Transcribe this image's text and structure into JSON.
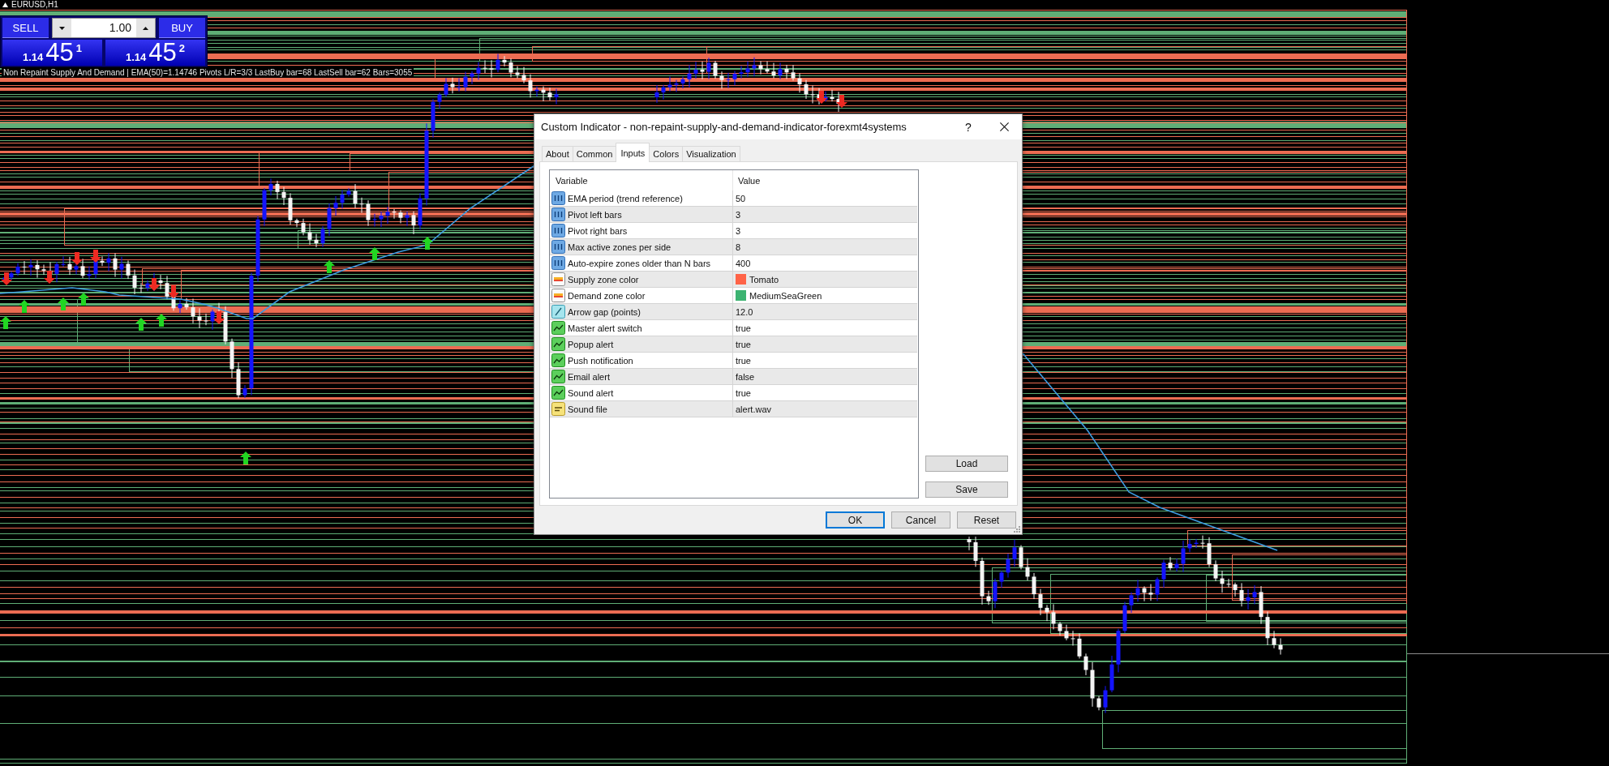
{
  "chart": {
    "symbol": "EURUSD,H1",
    "status": "Non Repaint Supply And Demand | EMA(50)=1.14746 Pivots L/R=3/3 LastBuy bar=68 LastSell bar=62 Bars=3055"
  },
  "trade_panel": {
    "sell_button": "SELL",
    "lot_size": {
      "value": "1.00"
    },
    "buy_button": "BUY",
    "sell_price": {
      "prefix": "1.14",
      "pips": "45",
      "fraction": "1"
    },
    "buy_price": {
      "prefix": "1.14",
      "pips": "45",
      "fraction": "2"
    }
  },
  "dialog": {
    "title": "Custom Indicator - non-repaint-supply-and-demand-indicator-forexmt4systems",
    "help_button": "?",
    "tabs": [
      {
        "label": "About",
        "selected": false
      },
      {
        "label": "Common",
        "selected": false
      },
      {
        "label": "Inputs",
        "selected": true
      },
      {
        "label": "Colors",
        "selected": false
      },
      {
        "label": "Visualization",
        "selected": false
      }
    ],
    "inputs": {
      "columns": [
        "Variable",
        "Value"
      ],
      "rows": [
        {
          "kind": "int",
          "variable": "EMA period (trend reference)",
          "value": "50"
        },
        {
          "kind": "int",
          "variable": "Pivot left bars",
          "value": "3"
        },
        {
          "kind": "int",
          "variable": "Pivot right bars",
          "value": "3"
        },
        {
          "kind": "int",
          "variable": "Max active zones per side",
          "value": "8"
        },
        {
          "kind": "int",
          "variable": "Auto-expire zones older than N bars",
          "value": "400"
        },
        {
          "kind": "color",
          "variable": "Supply zone color",
          "value": "Tomato",
          "color": "#ff6347"
        },
        {
          "kind": "color",
          "variable": "Demand zone color",
          "value": "MediumSeaGreen",
          "color": "#3cb371"
        },
        {
          "kind": "double",
          "variable": "Arrow gap (points)",
          "value": "12.0"
        },
        {
          "kind": "bool",
          "variable": "Master alert switch",
          "value": "true"
        },
        {
          "kind": "bool",
          "variable": "Popup alert",
          "value": "true"
        },
        {
          "kind": "bool",
          "variable": "Push notification",
          "value": "true"
        },
        {
          "kind": "bool",
          "variable": "Email alert",
          "value": "false"
        },
        {
          "kind": "bool",
          "variable": "Sound alert",
          "value": "true"
        },
        {
          "kind": "string",
          "variable": "Sound file",
          "value": "alert.wav"
        }
      ]
    },
    "side_buttons": [
      "Load",
      "Save"
    ],
    "buttons": [
      {
        "label": "OK",
        "default": true
      },
      {
        "label": "Cancel",
        "default": false
      },
      {
        "label": "Reset",
        "default": false
      }
    ]
  }
}
